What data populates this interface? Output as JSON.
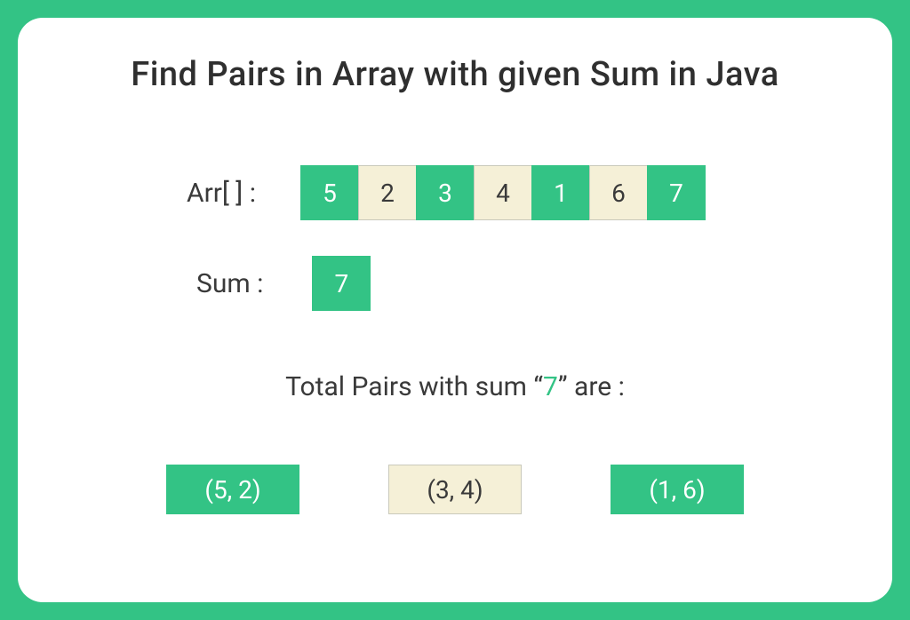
{
  "title": "Find Pairs in Array with given Sum in  Java",
  "arr_label": "Arr[ ] :",
  "sum_label": "Sum :",
  "arr": [
    "5",
    "2",
    "3",
    "4",
    "1",
    "6",
    "7"
  ],
  "sum_value": "7",
  "total_text_before": "Total Pairs with sum “",
  "total_text_value": "7",
  "total_text_after": "” are :",
  "pairs": {
    "p1": "(5, 2)",
    "p2": "(3, 4)",
    "p3": "(1, 6)"
  }
}
